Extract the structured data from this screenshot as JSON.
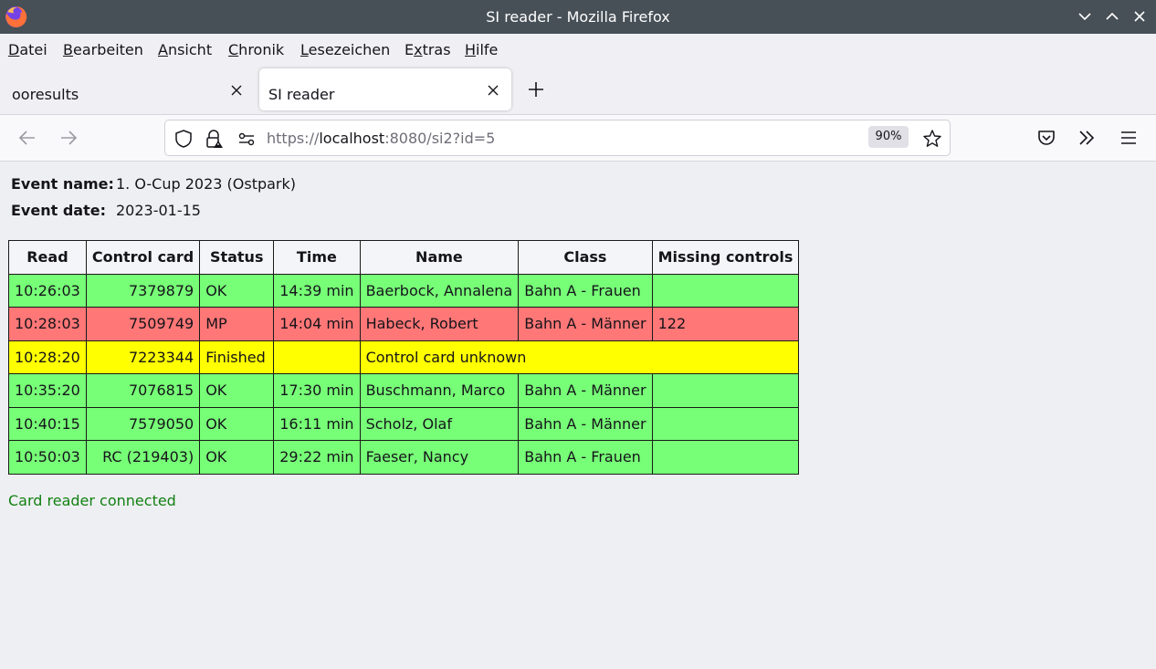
{
  "window": {
    "title": "SI reader - Mozilla Firefox"
  },
  "menu": {
    "items": [
      {
        "first": "D",
        "rest": "atei"
      },
      {
        "first": "B",
        "rest": "earbeiten"
      },
      {
        "first": "A",
        "rest": "nsicht"
      },
      {
        "first": "C",
        "rest": "hronik"
      },
      {
        "first": "L",
        "rest": "esezeichen"
      },
      {
        "pre": "E",
        "first": "x",
        "rest": "tras"
      },
      {
        "first": "H",
        "rest": "ilfe"
      }
    ]
  },
  "tabs": [
    {
      "label": "ooresults",
      "active": false
    },
    {
      "label": "SI reader",
      "active": true
    }
  ],
  "nav": {
    "url_scheme": "https://",
    "url_host": "localhost",
    "url_rest": ":8080/si2?id=5",
    "zoom": "90%"
  },
  "event": {
    "name_label": "Event name:",
    "name_value": "1. O-Cup 2023 (Ostpark)",
    "date_label": "Event date:",
    "date_value": "2023-01-15"
  },
  "table": {
    "headers": [
      "Read",
      "Control card",
      "Status",
      "Time",
      "Name",
      "Class",
      "Missing controls"
    ],
    "rows": [
      {
        "read": "10:26:03",
        "card": "7379879",
        "status": "OK",
        "time": "14:39 min",
        "name": "Baerbock, Annalena",
        "class": "Bahn A - Frauen",
        "missing": "",
        "color": "#77ff77"
      },
      {
        "read": "10:28:03",
        "card": "7509749",
        "status": "MP",
        "time": "14:04 min",
        "name": "Habeck, Robert",
        "class": "Bahn A - Männer",
        "missing": "122",
        "color": "#ff7777"
      },
      {
        "read": "10:28:20",
        "card": "7223344",
        "status": "Finished",
        "time": "",
        "message": "Control card unknown",
        "color": "#ffff00"
      },
      {
        "read": "10:35:20",
        "card": "7076815",
        "status": "OK",
        "time": "17:30 min",
        "name": "Buschmann, Marco",
        "class": "Bahn A - Männer",
        "missing": "",
        "color": "#77ff77"
      },
      {
        "read": "10:40:15",
        "card": "7579050",
        "status": "OK",
        "time": "16:11 min",
        "name": "Scholz, Olaf",
        "class": "Bahn A - Männer",
        "missing": "",
        "color": "#77ff77"
      },
      {
        "read": "10:50:03",
        "card": "RC (219403)",
        "status": "OK",
        "time": "29:22 min",
        "name": "Faeser, Nancy",
        "class": "Bahn A - Frauen",
        "missing": "",
        "color": "#77ff77"
      }
    ]
  },
  "status": {
    "text": "Card reader connected",
    "color": "#128112"
  },
  "colors": {
    "titlebar": "#475057",
    "ok": "#77ff77",
    "error": "#ff7777",
    "unknown": "#ffff00"
  },
  "icons": [
    "firefox-logo-icon",
    "minimize-icon",
    "maximize-icon",
    "close-window-icon",
    "close-tab-icon",
    "new-tab-icon",
    "back-icon",
    "forward-icon",
    "shield-icon",
    "lock-warning-icon",
    "permissions-icon",
    "bookmark-star-icon",
    "pocket-icon",
    "overflow-icon",
    "app-menu-icon"
  ]
}
